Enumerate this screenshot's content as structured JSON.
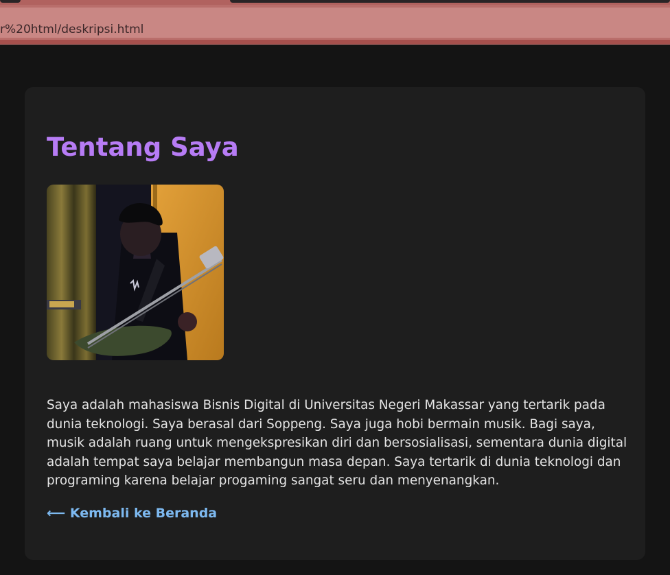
{
  "browser": {
    "url": "r%20html/deskripsi.html"
  },
  "about": {
    "title": "Tentang Saya",
    "photo_icon": "profile-photo",
    "description": "Saya adalah mahasiswa Bisnis Digital di Universitas Negeri Makassar yang tertarik pada dunia teknologi. Saya berasal dari Soppeng. Saya juga hobi bermain musik. Bagi saya, musik adalah ruang untuk mengekspresikan diri dan bersosialisasi, sementara dunia digital adalah tempat saya belajar membangun masa depan. Saya tertarik di dunia teknologi dan programing karena belajar progaming sangat seru dan menyenangkan.",
    "back_link": "⟵ Kembali ke Beranda"
  },
  "colors": {
    "page_background": "#141414",
    "card_background": "#1e1e1e",
    "title": "#b77cf5",
    "link": "#7db9f0",
    "text": "#e4e4e4"
  }
}
